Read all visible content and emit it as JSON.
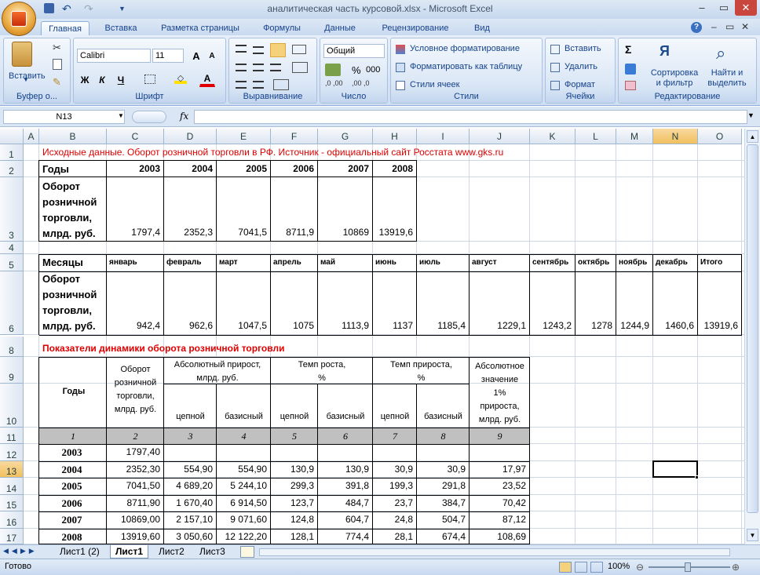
{
  "app": {
    "window_title": "аналитическая часть курсовой.xlsx - Microsoft Excel",
    "help_icon": "?"
  },
  "tabs": [
    "Главная",
    "Вставка",
    "Разметка страницы",
    "Формулы",
    "Данные",
    "Рецензирование",
    "Вид"
  ],
  "ribbon": {
    "clipboard": {
      "label": "Буфер о...",
      "paste": "Вставить"
    },
    "font": {
      "label": "Шрифт",
      "name": "Calibri",
      "size": "11",
      "grow": "A",
      "shrink": "A",
      "bold": "Ж",
      "italic": "К",
      "underline": "Ч",
      "color_a": "A"
    },
    "align": {
      "label": "Выравнивание"
    },
    "number": {
      "label": "Число",
      "format": "Общий",
      "percent": "%",
      "thousands": "000"
    },
    "styles": {
      "label": "Стили",
      "cond": "Условное форматирование",
      "table": "Форматировать как таблицу",
      "cell": "Стили ячеек"
    },
    "cells": {
      "label": "Ячейки",
      "insert": "Вставить",
      "delete": "Удалить",
      "format": "Формат"
    },
    "editing": {
      "label": "Редактирование",
      "sort": "Сортировка и фильтр",
      "find": "Найти и выделить",
      "sigma": "Σ"
    }
  },
  "formula_bar": {
    "name_box": "N13",
    "fx": "fx",
    "value": ""
  },
  "columns": [
    "A",
    "B",
    "C",
    "D",
    "E",
    "F",
    "G",
    "H",
    "I",
    "J",
    "K",
    "L",
    "M",
    "N",
    "O"
  ],
  "rows": [
    "1",
    "2",
    "3",
    "4",
    "5",
    "6",
    "8",
    "9",
    "10",
    "11",
    "12",
    "13",
    "14",
    "15",
    "16",
    "17"
  ],
  "sheet": {
    "r1": "Исходные данные. Оборот розничной торговли в РФ. Источник - официальный  сайт Росстата www.gks.ru",
    "years_label": "Годы",
    "years": [
      "2003",
      "2004",
      "2005",
      "2006",
      "2007",
      "2008"
    ],
    "turnover_label": [
      "Оборот",
      "розничной",
      "торговли,",
      "млрд. руб."
    ],
    "turnover": [
      "1797,4",
      "2352,3",
      "7041,5",
      "8711,9",
      "10869",
      "13919,6"
    ],
    "months_label": "Месяцы",
    "months": [
      "январь",
      "февраль",
      "март",
      "апрель",
      "май",
      "июнь",
      "июль",
      "август",
      "сентябрь",
      "октябрь",
      "ноябрь",
      "декабрь",
      "Итого"
    ],
    "monthly": [
      "942,4",
      "962,6",
      "1047,5",
      "1075",
      "1113,9",
      "1137",
      "1185,4",
      "1229,1",
      "1243,2",
      "1278",
      "1244,9",
      "1460,6",
      "13919,6"
    ],
    "r8": "Показатели динамики оборота розничной торговли",
    "h_years": "Годы",
    "h_turnover": [
      "Оборот",
      "розничной",
      "торговли,",
      "млрд. руб."
    ],
    "h_abs": [
      "Абсолютный прирост,",
      "млрд. руб."
    ],
    "h_growth": [
      "Темп роста,",
      "%"
    ],
    "h_increase": [
      "Темп прироста,",
      "%"
    ],
    "h_onepct": [
      "Абсолютное",
      "значение",
      "1%",
      "прироста,",
      "млрд. руб."
    ],
    "h_chain": "цепной",
    "h_base": "базисный",
    "idx": [
      "1",
      "2",
      "3",
      "4",
      "5",
      "6",
      "7",
      "8",
      "9"
    ],
    "table": [
      [
        "2003",
        "1797,40",
        "",
        "",
        "",
        "",
        "",
        "",
        ""
      ],
      [
        "2004",
        "2352,30",
        "554,90",
        "554,90",
        "130,9",
        "130,9",
        "30,9",
        "30,9",
        "17,97"
      ],
      [
        "2005",
        "7041,50",
        "4 689,20",
        "5 244,10",
        "299,3",
        "391,8",
        "199,3",
        "291,8",
        "23,52"
      ],
      [
        "2006",
        "8711,90",
        "1 670,40",
        "6 914,50",
        "123,7",
        "484,7",
        "23,7",
        "384,7",
        "70,42"
      ],
      [
        "2007",
        "10869,00",
        "2 157,10",
        "9 071,60",
        "124,8",
        "604,7",
        "24,8",
        "504,7",
        "87,12"
      ],
      [
        "2008",
        "13919,60",
        "3 050,60",
        "12 122,20",
        "128,1",
        "774,4",
        "28,1",
        "674,4",
        "108,69"
      ]
    ]
  },
  "sheet_tabs": [
    "Лист1 (2)",
    "Лист1",
    "Лист2",
    "Лист3"
  ],
  "active_sheet": "Лист1",
  "status": {
    "ready": "Готово",
    "zoom": "100%"
  },
  "colors": {
    "red": "#e00000",
    "accent": "#15428b"
  }
}
